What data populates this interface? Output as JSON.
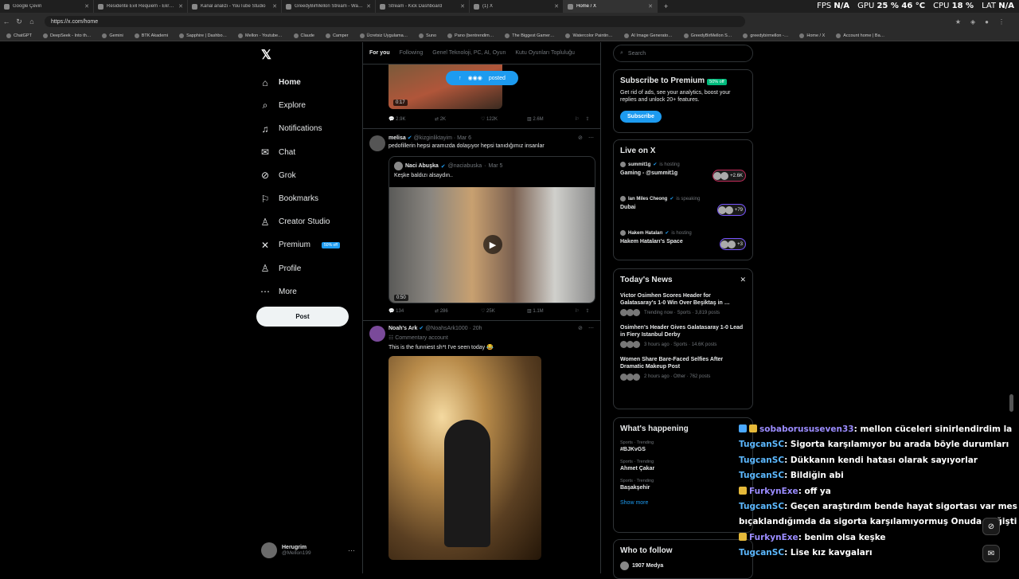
{
  "tabs": [
    {
      "title": "Google Çeviri",
      "active": false
    },
    {
      "title": "Residente Evil Requiem - Ekran…",
      "active": false
    },
    {
      "title": "Kanal analizi - YouTube Studio",
      "active": false
    },
    {
      "title": "GreedyBirMellon Stream - Watch…",
      "active": false
    },
    {
      "title": "Stream - Kick Dashboard",
      "active": false
    },
    {
      "title": "(1) X",
      "active": false
    },
    {
      "title": "Home / X",
      "active": true
    }
  ],
  "hud": {
    "fps_label": "FPS",
    "fps": "N/A",
    "gpu_label": "GPU",
    "gpu": "25 % 46 °C",
    "cpu_label": "CPU",
    "cpu": "18 %",
    "lat_label": "LAT",
    "lat": "N/A"
  },
  "url": "https://x.com/home",
  "bookmarks": [
    "ChatGPT",
    "DeepSeek - Into th…",
    "Gemini",
    "BTK Akademi",
    "Sapphire | Dashbo…",
    "Mellon - Youtube…",
    "Claude",
    "Camper",
    "Ücretsiz Uygulama…",
    "Suno",
    "Pano (bentrendim…",
    "The Biggest Gamer…",
    "Watercolor Paintin…",
    "AI Image Generato…",
    "GreedyBirMellon S…",
    "greedybirmellon -…",
    "Home / X",
    "Account home | Ba…"
  ],
  "sidebar": {
    "items": [
      {
        "label": "Home",
        "icon": "home-icon",
        "glyph": "⌂"
      },
      {
        "label": "Explore",
        "icon": "search-icon",
        "glyph": "⌕"
      },
      {
        "label": "Notifications",
        "icon": "bell-icon",
        "glyph": "♫"
      },
      {
        "label": "Chat",
        "icon": "mail-icon",
        "glyph": "✉"
      },
      {
        "label": "Grok",
        "icon": "grok-icon",
        "glyph": "⊘"
      },
      {
        "label": "Bookmarks",
        "icon": "bookmark-icon",
        "glyph": "⚐"
      },
      {
        "label": "Creator Studio",
        "icon": "creator-icon",
        "glyph": "♙"
      },
      {
        "label": "Premium",
        "icon": "x-premium-icon",
        "glyph": "✕",
        "badge": "50% off"
      },
      {
        "label": "Profile",
        "icon": "profile-icon",
        "glyph": "♙"
      },
      {
        "label": "More",
        "icon": "more-icon",
        "glyph": "⋯"
      }
    ],
    "post_button": "Post",
    "account": {
      "name": "Herugrim",
      "handle": "@Mellon199"
    }
  },
  "feed": {
    "tabs": [
      "For you",
      "Following",
      "Genel Teknoloji, PC, AI, Oyun",
      "Kutu Oyunları Topluluğu"
    ],
    "posted_label": "posted",
    "post1": {
      "duration": "0:17",
      "replies": "2.9K",
      "reposts": "2K",
      "likes": "122K",
      "views": "2.6M"
    },
    "post2": {
      "name": "melisa",
      "handle": "@kizginliktayim",
      "time": "Mar 6",
      "text": "pedofillerin hepsi aramızda dolaşıyor hepsi tanıdığımız insanlar",
      "quote": {
        "name": "Naci Abuşka",
        "handle": "@naciabuska",
        "time": "Mar 5",
        "text": "Keşke baldızı alsaydın..",
        "duration": "0:50"
      },
      "replies": "134",
      "reposts": "286",
      "likes": "25K",
      "views": "1.1M"
    },
    "post3": {
      "name": "Noah's Ark",
      "handle": "@NoahsArk1000",
      "time": "20h",
      "label": "Commentary account",
      "text": "This is the funniest sh*t I've seen today 😂"
    }
  },
  "right": {
    "search_placeholder": "Search",
    "premium": {
      "title": "Subscribe to Premium",
      "badge": "50% off",
      "text": "Get rid of ads, see your analytics, boost your replies and unlock 20+ features.",
      "button": "Subscribe"
    },
    "live": {
      "title": "Live on X",
      "items": [
        {
          "host": "summit1g",
          "status": "is hosting",
          "title": "Gaming - @summit1g",
          "count": "+2.6K"
        },
        {
          "host": "Ian Miles Cheong",
          "status": "is speaking",
          "title": "Dubai",
          "count": "+79"
        },
        {
          "host": "Hakem Hataları",
          "status": "is hosting",
          "title": "Hakem Hataları's Space",
          "count": "+3"
        }
      ]
    },
    "news": {
      "title": "Today's News",
      "items": [
        {
          "title": "Victor Osimhen Scores Header for Galatasaray's 1-0 Win Over Beşiktaş in …",
          "meta": "Trending now · Sports · 3,819 posts"
        },
        {
          "title": "Osimhen's Header Gives Galatasaray 1-0 Lead in Fiery Istanbul Derby",
          "meta": "3 hours ago · Sports · 14.6K posts"
        },
        {
          "title": "Women Share Bare-Faced Selfies After Dramatic Makeup Post",
          "meta": "2 hours ago · Other · 762 posts"
        }
      ]
    },
    "happening": {
      "title": "What's happening",
      "items": [
        {
          "context": "Sports · Trending",
          "name": "#BJKvGS"
        },
        {
          "context": "Sports · Trending",
          "name": "Ahmet Çakar"
        },
        {
          "context": "Sports · Trending",
          "name": "Başakşehir"
        }
      ],
      "show_more": "Show more"
    },
    "follow": {
      "title": "Who to follow",
      "first": "1907 Medya"
    }
  },
  "chat": [
    {
      "user": "sobaborususeven33",
      "msg": ": mellon cüceleri sinirlendirdim la",
      "badge": "b"
    },
    {
      "user": "TugcanSC",
      "msg": ": Sigorta karşılamıyor bu arada böyle durumları",
      "badge": ""
    },
    {
      "user": "TugcanSC",
      "msg": ": Dükkanın kendi hatası olarak sayıyorlar",
      "badge": ""
    },
    {
      "user": "TugcanSC",
      "msg": ": Bildiğin abi",
      "badge": ""
    },
    {
      "user": "FurkynExe",
      "msg": ": off ya",
      "badge": "y"
    },
    {
      "user": "TugcanSC",
      "msg": ": Geçen araştırdım bende hayat sigortası var mesela ben",
      "badge": ""
    },
    {
      "user": "",
      "msg": "bıçaklandığımda da sigorta karşılamıyormuş Onuda değiştiricem",
      "badge": ""
    },
    {
      "user": "FurkynExe",
      "msg": ": benim olsa keşke",
      "badge": "y"
    },
    {
      "user": "TugcanSC",
      "msg": ": Lise kız kavgaları",
      "badge": ""
    }
  ]
}
